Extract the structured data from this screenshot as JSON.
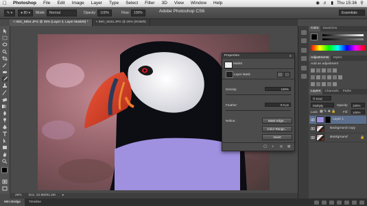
{
  "menubar": {
    "app_name": "Photoshop",
    "items": [
      "File",
      "Edit",
      "Image",
      "Layer",
      "Type",
      "Select",
      "Filter",
      "3D",
      "View",
      "Window",
      "Help"
    ],
    "clock": "Thu 15:36"
  },
  "options_bar": {
    "mode_label": "Mode:",
    "mode_value": "Normal",
    "opacity_label": "Opacity:",
    "opacity_value": "100%",
    "flow_label": "Flow:",
    "flow_value": "100%",
    "app_title": "Adobe Photoshop CS6",
    "workspace": "Essentials"
  },
  "doc_tabs": [
    {
      "label": "IMG_5854.JPG @ 25% (Layer 3, Layer Mask/8) *",
      "active": true
    },
    {
      "label": "IMG_5532.JPG @ 25% (RGB/8)",
      "active": false
    }
  ],
  "status_bar": {
    "zoom": "25%",
    "doc_size": "Doc: 22.8M/91.2M"
  },
  "bottom_tabs": [
    "Mini Bridge",
    "Timeline"
  ],
  "properties": {
    "panel_title": "Properties",
    "section": "Masks",
    "mask_type": "Layer Mask",
    "density_label": "Density:",
    "density_value": "100%",
    "feather_label": "Feather:",
    "feather_value": "0.0 px",
    "refine_label": "Refine:",
    "mask_edge_btn": "Mask Edge...",
    "color_range_btn": "Color Range...",
    "invert_btn": "Invert"
  },
  "right_panels": {
    "color_tabs": [
      "Color",
      "Swatches"
    ],
    "adj_tabs": [
      "Adjustments",
      "Styles"
    ],
    "adj_title": "Add an adjustment",
    "layers_tabs": [
      "Layers",
      "Channels",
      "Paths"
    ],
    "kind_label": "Kind",
    "blend_mode": "Multiply",
    "opacity_label": "Opacity:",
    "opacity_value": "100%",
    "lock_label": "Lock:",
    "fill_label": "Fill:",
    "fill_value": "100%",
    "layers": [
      {
        "name": "Layer 1",
        "selected": true
      },
      {
        "name": "Background copy",
        "selected": false
      },
      {
        "name": "Background",
        "selected": false
      }
    ]
  },
  "colors": {
    "mask_fill": "#a090e0",
    "ui_dark": "#3a3a3a",
    "selection": "#5d6f8e"
  }
}
